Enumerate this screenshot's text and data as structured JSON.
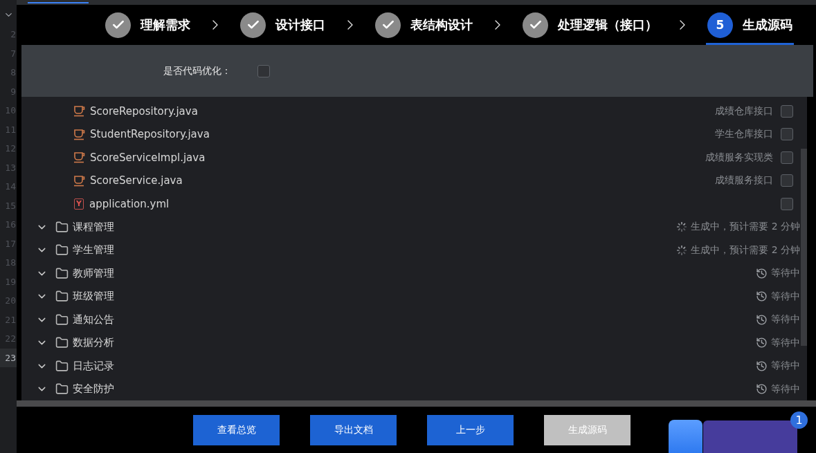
{
  "gutter": {
    "lines": [
      {
        "number": "2",
        "selected": false
      },
      {
        "number": "7",
        "selected": false
      },
      {
        "number": "8",
        "selected": false
      },
      {
        "number": "9",
        "selected": false
      },
      {
        "number": "10",
        "selected": false
      },
      {
        "number": "11",
        "selected": false
      },
      {
        "number": "12",
        "selected": false
      },
      {
        "number": "13",
        "selected": false
      },
      {
        "number": "14",
        "selected": false
      },
      {
        "number": "15",
        "selected": false
      },
      {
        "number": "16",
        "selected": false
      },
      {
        "number": "17",
        "selected": false
      },
      {
        "number": "18",
        "selected": false
      },
      {
        "number": "19",
        "selected": false
      },
      {
        "number": "20",
        "selected": false
      },
      {
        "number": "21",
        "selected": false
      },
      {
        "number": "22",
        "selected": false
      },
      {
        "number": "23",
        "selected": true
      }
    ]
  },
  "steps": [
    {
      "label": "理解需求",
      "completed": true,
      "selected": false
    },
    {
      "label": "设计接口",
      "completed": true,
      "selected": false
    },
    {
      "label": "表结构设计",
      "completed": true,
      "selected": false
    },
    {
      "label": "处理逻辑（接口）",
      "completed": true,
      "selected": false
    },
    {
      "label": "生成源码",
      "completed": false,
      "selected": true,
      "number": "5"
    }
  ],
  "option": {
    "label": "是否代码优化：",
    "checked": false
  },
  "files": [
    {
      "kind": "java",
      "name": "ScoreRepository.java",
      "description": "成绩仓库接口",
      "checked": false
    },
    {
      "kind": "java",
      "name": "StudentRepository.java",
      "description": "学生仓库接口",
      "checked": false
    },
    {
      "kind": "java",
      "name": "ScoreServiceImpl.java",
      "description": "成绩服务实现类",
      "checked": false
    },
    {
      "kind": "java",
      "name": "ScoreService.java",
      "description": "成绩服务接口",
      "checked": false
    },
    {
      "kind": "yml",
      "name": "application.yml",
      "icon_letter": "Y",
      "checked": false
    }
  ],
  "folders": [
    {
      "name": "课程管理",
      "expanded": true,
      "kind": "generating",
      "status_text": "生成中，预计需要 2 分钟"
    },
    {
      "name": "学生管理",
      "expanded": true,
      "kind": "generating",
      "status_text": "生成中，预计需要 2 分钟"
    },
    {
      "name": "教师管理",
      "expanded": true,
      "kind": "waiting",
      "status_text": "等待中"
    },
    {
      "name": "班级管理",
      "expanded": true,
      "kind": "waiting",
      "status_text": "等待中"
    },
    {
      "name": "通知公告",
      "expanded": true,
      "kind": "waiting",
      "status_text": "等待中"
    },
    {
      "name": "数据分析",
      "expanded": true,
      "kind": "waiting",
      "status_text": "等待中"
    },
    {
      "name": "日志记录",
      "expanded": true,
      "kind": "waiting",
      "status_text": "等待中"
    },
    {
      "name": "安全防护",
      "expanded": true,
      "kind": "waiting",
      "status_text": "等待中"
    }
  ],
  "buttons": [
    {
      "label": "查看总览",
      "disabled": false
    },
    {
      "label": "导出文档",
      "disabled": false
    },
    {
      "label": "上一步",
      "disabled": false
    },
    {
      "label": "生成源码",
      "disabled": true
    }
  ],
  "assistant_widget": {
    "badge": "1"
  }
}
